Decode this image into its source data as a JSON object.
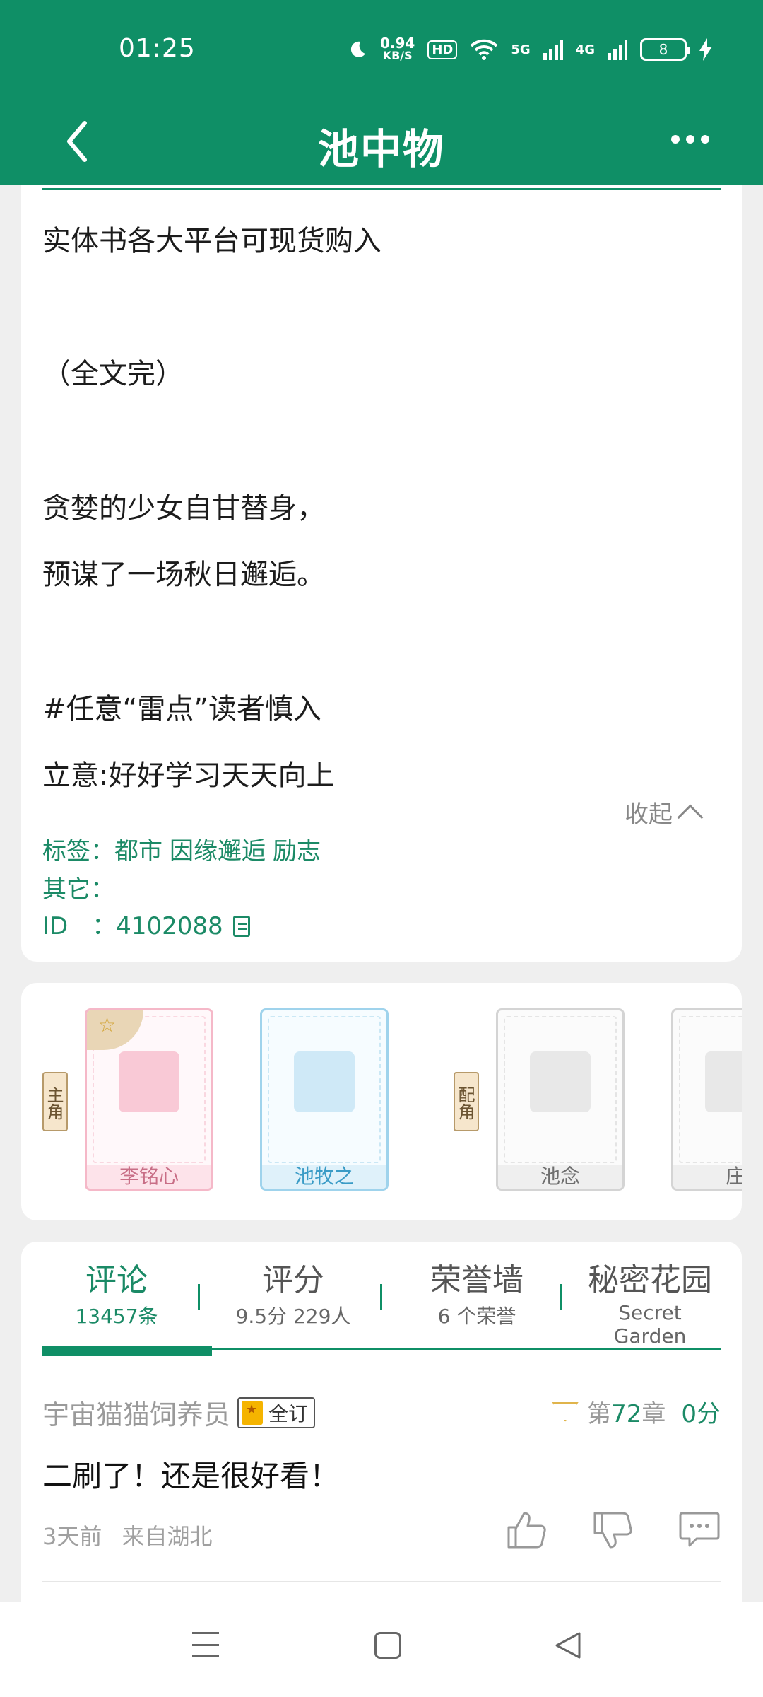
{
  "status_bar": {
    "time": "01:25",
    "speed_value": "0.94",
    "speed_unit": "KB/S",
    "hd": "HD",
    "net1": "5G",
    "net2": "4G",
    "battery": "8"
  },
  "nav": {
    "title": "池中物"
  },
  "intro": {
    "lines": [
      "实体书各大平台可现货购入",
      "（全文完）",
      "贪婪的少女自甘替身，",
      "预谋了一场秋日邂逅。",
      "#任意“雷点”读者慎入",
      "立意:好好学习天天向上"
    ],
    "collapse_label": "收起",
    "tags_label": "标签：",
    "tags": [
      "都市",
      "因缘邂逅",
      "励志"
    ],
    "other_label": "其它：",
    "id_label": "ID　：",
    "id_value": "4102088"
  },
  "characters": {
    "main_tag": "主角",
    "support_tag": "配角",
    "items": [
      {
        "name": "李铭心"
      },
      {
        "name": "池牧之"
      },
      {
        "name": "池念"
      },
      {
        "name": "庄"
      }
    ]
  },
  "tabs": [
    {
      "title": "评论",
      "sub": "13457条"
    },
    {
      "title": "评分",
      "sub": "9.5分 229人"
    },
    {
      "title": "荣誉墙",
      "sub": "6 个荣誉"
    },
    {
      "title": "秘密花园",
      "sub": "Secret Garden"
    }
  ],
  "comment": {
    "user": "宇宙猫猫饲养员",
    "badge": "全订",
    "chapter_prefix": "第",
    "chapter_num": "72",
    "chapter_suffix": "章",
    "score": "0分",
    "text": "二刷了！还是很好看！",
    "time": "3天前",
    "location": "来自湖北"
  },
  "colors": {
    "brand": "#0f8f66",
    "link": "#1b8a66"
  }
}
